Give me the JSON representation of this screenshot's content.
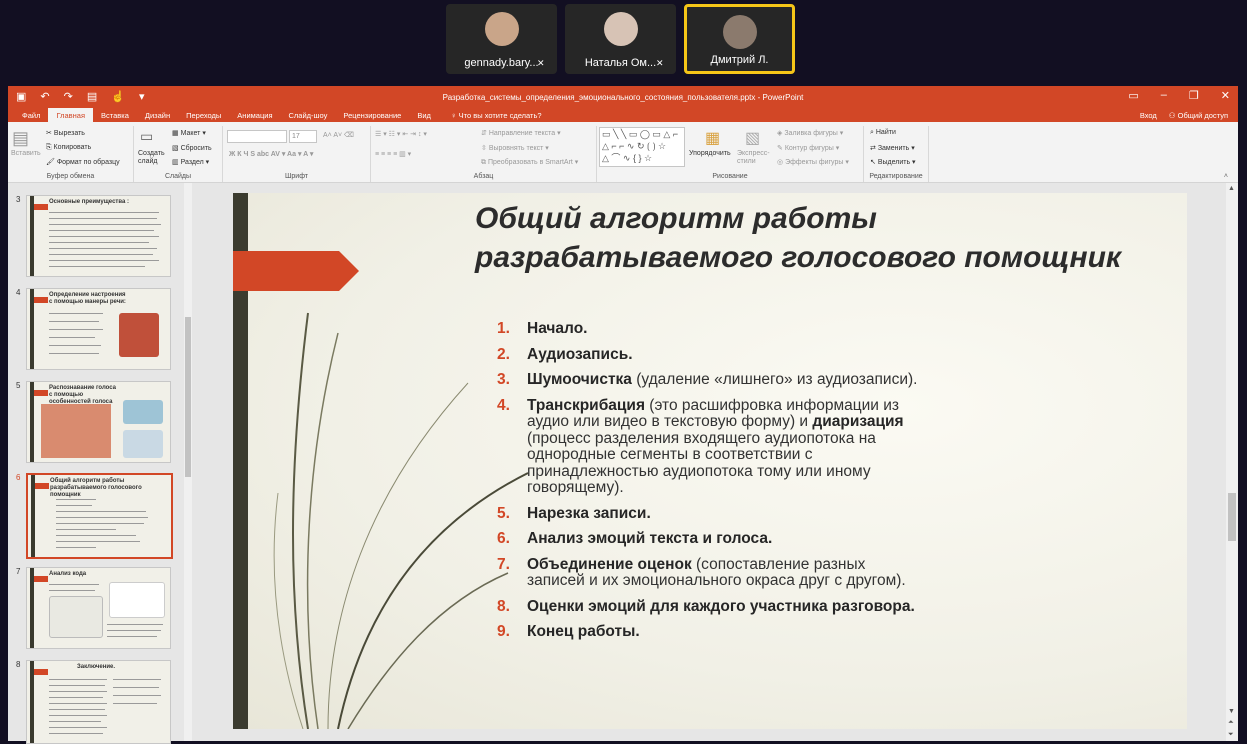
{
  "participants": [
    {
      "name": "gennady.bary...",
      "muted": true,
      "color": "#1f4c8a",
      "active": false
    },
    {
      "name": "Наталья Ом...",
      "muted": true,
      "color": "#6c7e8e",
      "active": false
    },
    {
      "name": "Дмитрий Л.",
      "muted": false,
      "color": "#8b7a6d",
      "active": true
    }
  ],
  "titlebar": {
    "doc_title": "Разработка_системы_определения_эмоционального_состояния_пользователя.pptx - PowerPoint"
  },
  "tabs": [
    "Файл",
    "Главная",
    "Вставка",
    "Дизайн",
    "Переходы",
    "Анимация",
    "Слайд-шоу",
    "Рецензирование",
    "Вид"
  ],
  "active_tab": "Главная",
  "tell_me": "Что вы хотите сделать?",
  "account": {
    "login": "Вход",
    "share": "Общий доступ"
  },
  "ribbon": {
    "clipboard": {
      "paste": "Вставить",
      "cut": "Вырезать",
      "copy": "Копировать",
      "format_painter": "Формат по образцу",
      "label": "Буфер обмена"
    },
    "slides": {
      "new_slide": "Создать слайд",
      "layout": "Макет",
      "reset": "Сбросить",
      "section": "Раздел",
      "label": "Слайды"
    },
    "font": {
      "size": "17",
      "label": "Шрифт"
    },
    "paragraph": {
      "text_direction": "Направление текста",
      "align_text": "Выровнять текст",
      "smartart": "Преобразовать в SmartArt",
      "label": "Абзац"
    },
    "drawing": {
      "arrange": "Упорядочить",
      "quick_styles": "Экспресс-стили",
      "fill": "Заливка фигуры",
      "outline": "Контур фигуры",
      "effects": "Эффекты фигуры",
      "label": "Рисование"
    },
    "editing": {
      "find": "Найти",
      "replace": "Заменить",
      "select": "Выделить",
      "label": "Редактирование"
    }
  },
  "thumbnails": [
    {
      "num": "3",
      "title": "Основные преимущества :",
      "selected": false
    },
    {
      "num": "4",
      "title": "Определение настроения с помощью манеры речи:",
      "selected": false
    },
    {
      "num": "5",
      "title": "Распознавание голоса с помощью особенностей голоса",
      "selected": false
    },
    {
      "num": "6",
      "title": "Общий алгоритм работы разрабатываемого голосового помощник",
      "selected": true
    },
    {
      "num": "7",
      "title": "Анализ кода",
      "selected": false
    },
    {
      "num": "8",
      "title": "Заключение.",
      "selected": false
    }
  ],
  "slide": {
    "title": "Общий алгоритм работы разрабатываемого голосового помощник",
    "items": [
      {
        "n": "1.",
        "bold": "Начало.",
        "rest": "",
        "bold2": "",
        "rest2": ""
      },
      {
        "n": "2.",
        "bold": "Аудиозапись.",
        "rest": "",
        "bold2": "",
        "rest2": ""
      },
      {
        "n": "3.",
        "bold": "Шумоочистка",
        "rest": " (удаление «лишнего» из аудиозаписи).",
        "bold2": "",
        "rest2": ""
      },
      {
        "n": "4.",
        "bold": "Транскрибация",
        "rest": " (это расшифровка информации из аудио или видео в текстовую форму) и ",
        "bold2": "диаризация",
        "rest2": " (процесс разделения входящего аудиопотока на однородные сегменты в соответствии с принадлежностью аудиопотока тому или иному говорящему)."
      },
      {
        "n": "5.",
        "bold": "Нарезка записи.",
        "rest": "",
        "bold2": "",
        "rest2": ""
      },
      {
        "n": "6.",
        "bold": "Анализ эмоций текста и голоса.",
        "rest": "",
        "bold2": "",
        "rest2": ""
      },
      {
        "n": "7.",
        "bold": "Объединение оценок",
        "rest": " (сопоставление разных записей и их эмоционального окраса друг с другом).",
        "bold2": "",
        "rest2": ""
      },
      {
        "n": "8.",
        "bold": "Оценки эмоций для каждого участника разговора.",
        "rest": "",
        "bold2": "",
        "rest2": ""
      },
      {
        "n": "9.",
        "bold": "Конец работы.",
        "rest": "",
        "bold2": "",
        "rest2": ""
      }
    ]
  },
  "colors": {
    "accent": "#d24726",
    "bar": "#3b3b2f",
    "highlight": "#f5c518"
  }
}
